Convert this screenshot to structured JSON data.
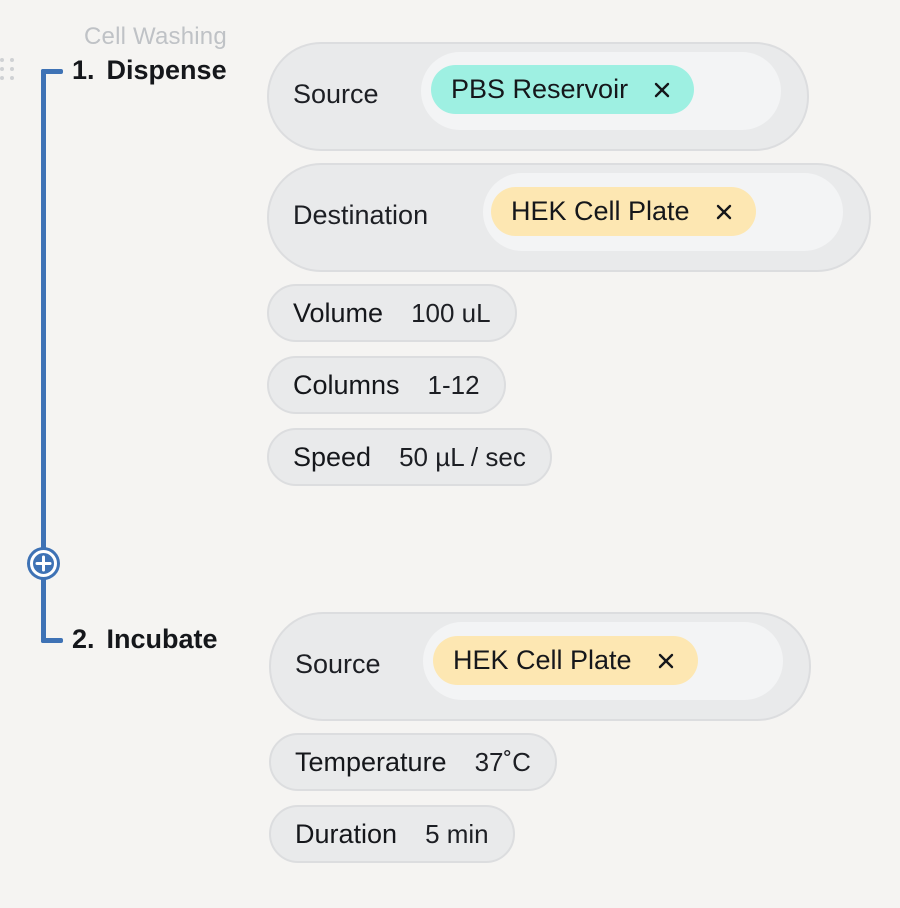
{
  "group": {
    "title": "Cell Washing"
  },
  "icons": {
    "drag_handle": "drag-handle-icon",
    "add_step": "plus-circle-icon",
    "remove_chip": "close-icon"
  },
  "colors": {
    "timeline": "#3e72b5",
    "chip_teal": "#9ef0e2",
    "chip_yellow": "#fde7b2"
  },
  "steps": [
    {
      "number": "1.",
      "name": "Dispense",
      "source": {
        "label": "Source",
        "chip": "PBS Reservoir"
      },
      "destination": {
        "label": "Destination",
        "chip": "HEK Cell Plate"
      },
      "params": [
        {
          "label": "Volume",
          "value": "100 uL"
        },
        {
          "label": "Columns",
          "value": "1-12"
        },
        {
          "label": "Speed",
          "value": "50 µL / sec"
        }
      ]
    },
    {
      "number": "2.",
      "name": "Incubate",
      "source": {
        "label": "Source",
        "chip": "HEK Cell Plate"
      },
      "params": [
        {
          "label": "Temperature",
          "value": "37˚C"
        },
        {
          "label": "Duration",
          "value": "5 min"
        }
      ]
    }
  ]
}
